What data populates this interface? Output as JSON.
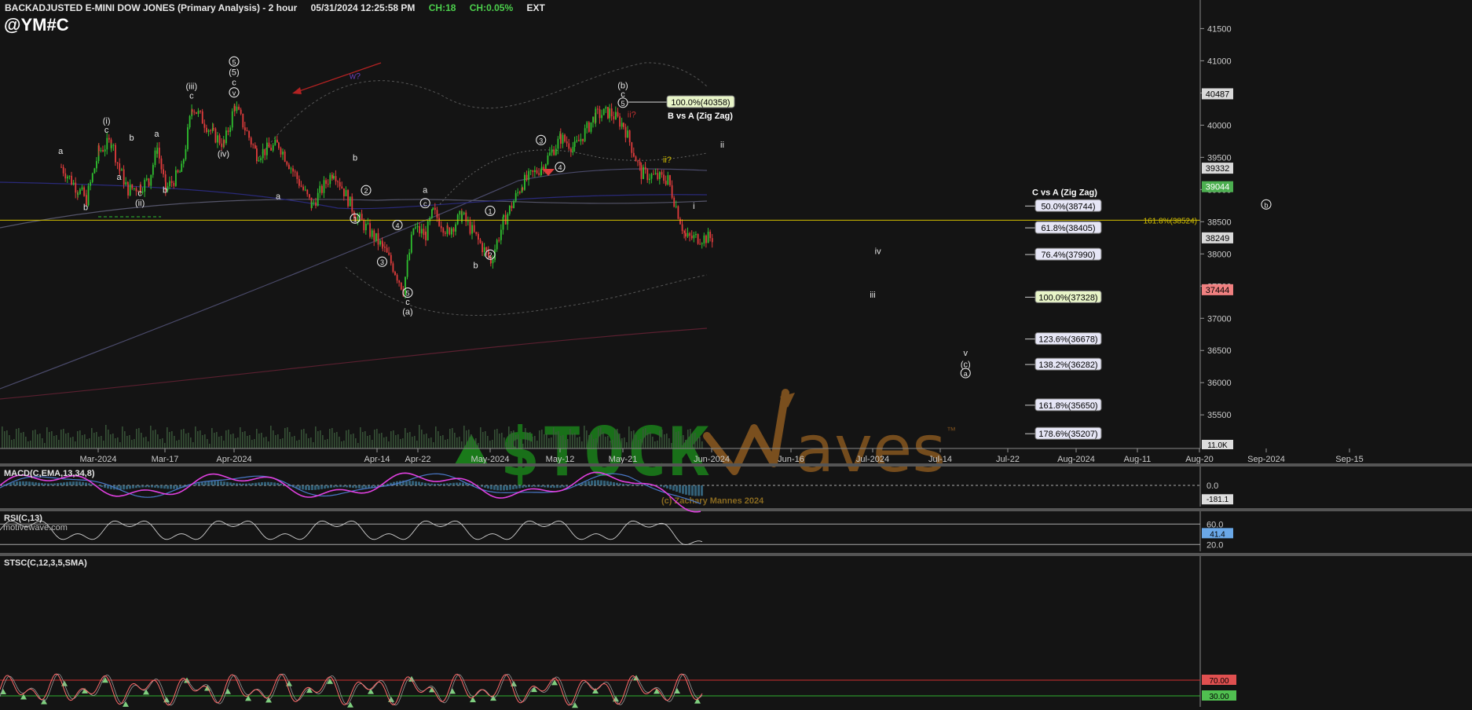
{
  "header": {
    "title": "BACKADJUSTED E-MINI DOW JONES (Primary Analysis) - 2 hour",
    "datetime": "05/31/2024 12:25:58 PM",
    "ch": "CH:18",
    "ch_pct": "CH:0.05%",
    "ext": "EXT",
    "symbol": "@YM#C"
  },
  "watermark": {
    "brand_left": "$TOCK",
    "brand_right": "aves",
    "tm": "™",
    "copyright": "(c) Zachary Mannes 2024",
    "credit": "motivewave.com"
  },
  "colors": {
    "background": "#141414",
    "up_candle": "#2fbf2f",
    "down_candle": "#e03c3c",
    "fib_line": "#d4c000",
    "macd": "#e040e0",
    "rsi": "#cfcfcf",
    "stoch": "#ff6b6b",
    "brand_green": "#1a7a1a",
    "brand_brown": "#7a4f1e"
  },
  "chart_data": {
    "type": "line",
    "title": "BACKADJUSTED E-MINI DOW JONES (Primary Analysis) - 2 hour",
    "x_ticks": [
      "Mar-2024",
      "Mar-17",
      "Apr-2024",
      "Apr-14",
      "Apr-22",
      "May-2024",
      "May-12",
      "May-21",
      "Jun-2024",
      "Jun-16",
      "Jul-2024",
      "Jul-14",
      "Jul-22",
      "Aug-2024",
      "Aug-11",
      "Aug-20",
      "Sep-2024",
      "Sep-15"
    ],
    "y_ticks": [
      35500,
      36000,
      36500,
      37000,
      37500,
      38000,
      38500,
      39000,
      39500,
      40000,
      40500,
      41000,
      41500
    ],
    "ylim": [
      35100,
      41700
    ],
    "price_path": [
      [
        "Feb-23",
        39350
      ],
      [
        "Feb-27",
        39000
      ],
      [
        "Feb-29",
        38850
      ],
      [
        "Mar-2024",
        39600
      ],
      [
        "Mar-04",
        39750
      ],
      [
        "Mar-06",
        39300
      ],
      [
        "Mar-08",
        39000
      ],
      [
        "Mar-11",
        39050
      ],
      [
        "Mar-13",
        39150
      ],
      [
        "Mar-15",
        39650
      ],
      [
        "Mar-17",
        39000
      ],
      [
        "Mar-20",
        39300
      ],
      [
        "Mar-22",
        40300
      ],
      [
        "Mar-26",
        39850
      ],
      [
        "Mar-28",
        39700
      ],
      [
        "Apr-2024",
        40300
      ],
      [
        "Apr-03",
        39550
      ],
      [
        "Apr-05",
        39700
      ],
      [
        "Apr-08",
        38750
      ],
      [
        "Apr-10",
        39300
      ],
      [
        "Apr-12",
        38600
      ],
      [
        "Apr-15",
        38100
      ],
      [
        "Apr-17",
        37800
      ],
      [
        "Apr-19",
        37450
      ],
      [
        "Apr-21",
        38400
      ],
      [
        "Apr-23",
        38300
      ],
      [
        "Apr-24",
        38650
      ],
      [
        "Apr-26",
        38350
      ],
      [
        "Apr-28",
        38600
      ],
      [
        "May-2024",
        37900
      ],
      [
        "May-03",
        38500
      ],
      [
        "May-06",
        39100
      ],
      [
        "May-09",
        39350
      ],
      [
        "May-12",
        39800
      ],
      [
        "May-14",
        39650
      ],
      [
        "May-17",
        40150
      ],
      [
        "May-19",
        40200
      ],
      [
        "May-21",
        40000
      ],
      [
        "May-23",
        39250
      ],
      [
        "May-26",
        39150
      ],
      [
        "May-28",
        38250
      ],
      [
        "May-31",
        38250
      ]
    ],
    "price_labels": [
      {
        "value": 40487,
        "label": "40487",
        "bg": "#d9d9d9",
        "fg": "#000"
      },
      {
        "value": 39332,
        "label": "39332",
        "bg": "#d9d9d9",
        "fg": "#000"
      },
      {
        "value": 39044,
        "label": "39044",
        "bg": "#4caf50",
        "fg": "#fff"
      },
      {
        "value": 38249,
        "label": "38249",
        "bg": "#d9d9d9",
        "fg": "#000"
      },
      {
        "value": 37444,
        "label": "37444",
        "bg": "#f08080",
        "fg": "#000"
      }
    ],
    "volume_label": "11.0K",
    "horizontal_line": {
      "value": 38524,
      "label": "161.8%(38524)"
    },
    "fib_targets_b": {
      "title": "B vs A (Zig Zag)",
      "levels": [
        {
          "label": "100.0%(40358)",
          "value": 40358
        }
      ]
    },
    "fib_targets_c": {
      "title": "C vs A (Zig Zag)",
      "levels": [
        {
          "label": "50.0%(38744)",
          "value": 38744
        },
        {
          "label": "61.8%(38405)",
          "value": 38405
        },
        {
          "label": "76.4%(37990)",
          "value": 37990
        },
        {
          "label": "100.0%(37328)",
          "value": 37328
        },
        {
          "label": "123.6%(36678)",
          "value": 36678
        },
        {
          "label": "138.2%(36282)",
          "value": 36282
        },
        {
          "label": "161.8%(35650)",
          "value": 35650
        },
        {
          "label": "178.6%(35207)",
          "value": 35207
        }
      ]
    },
    "wave_labels": [
      {
        "t": "a",
        "x": "Feb-23",
        "p": 39550
      },
      {
        "t": "b",
        "x": "Feb-29",
        "p": 38680
      },
      {
        "t": "(i)",
        "x": "Mar-03",
        "p": 40020
      },
      {
        "t": "c",
        "x": "Mar-03",
        "p": 39880
      },
      {
        "t": "a",
        "x": "Mar-06",
        "p": 39150
      },
      {
        "t": "b",
        "x": "Mar-09",
        "p": 39760
      },
      {
        "t": "c",
        "x": "Mar-11",
        "p": 38900
      },
      {
        "t": "(ii)",
        "x": "Mar-11",
        "p": 38750
      },
      {
        "t": "a",
        "x": "Mar-15",
        "p": 39820
      },
      {
        "t": "b",
        "x": "Mar-17",
        "p": 38950
      },
      {
        "t": "(iii)",
        "x": "Mar-22",
        "p": 40560
      },
      {
        "t": "c",
        "x": "Mar-22",
        "p": 40410
      },
      {
        "t": "(iv)",
        "x": "Mar-28",
        "p": 39510
      },
      {
        "t": "5",
        "x": "Apr-2024",
        "p": 40940,
        "circle": true
      },
      {
        "t": "(5)",
        "x": "Apr-2024",
        "p": 40780
      },
      {
        "t": "c",
        "x": "Apr-2024",
        "p": 40620
      },
      {
        "t": "v",
        "x": "Apr-2024",
        "p": 40460,
        "circle": true
      },
      {
        "t": "a",
        "x": "Apr-05",
        "p": 38850
      },
      {
        "t": "b",
        "x": "Apr-12",
        "p": 39450
      },
      {
        "t": "2",
        "x": "Apr-13",
        "p": 38940,
        "circle": true
      },
      {
        "t": "1",
        "x": "Apr-12",
        "p": 38500,
        "circle": true
      },
      {
        "t": "3",
        "x": "Apr-15",
        "p": 37830,
        "circle": true
      },
      {
        "t": "4",
        "x": "Apr-18",
        "p": 38400,
        "circle": true
      },
      {
        "t": "5",
        "x": "Apr-20",
        "p": 37350,
        "circle": true
      },
      {
        "t": "c",
        "x": "Apr-20",
        "p": 37210
      },
      {
        "t": "(a)",
        "x": "Apr-20",
        "p": 37060
      },
      {
        "t": "a",
        "x": "Apr-23",
        "p": 38950
      },
      {
        "t": "c",
        "x": "Apr-23",
        "p": 38740,
        "circle": true
      },
      {
        "t": "1",
        "x": "May-2024",
        "p": 38620,
        "circle": true
      },
      {
        "t": "2",
        "x": "May-2024",
        "p": 37940,
        "circle": true
      },
      {
        "t": "b",
        "x": "Apr-30",
        "p": 37780
      },
      {
        "t": "3",
        "x": "May-09",
        "p": 39720,
        "circle": true
      },
      {
        "t": "4",
        "x": "May-12",
        "p": 39300,
        "circle": true
      },
      {
        "t": "(b)",
        "x": "May-21",
        "p": 40570
      },
      {
        "t": "c",
        "x": "May-21",
        "p": 40440
      },
      {
        "t": "5",
        "x": "May-21",
        "p": 40300,
        "circle": true
      },
      {
        "t": "ii?",
        "x": "May-22",
        "p": 40120
      },
      {
        "t": "ii?",
        "x": "May-26",
        "p": 39420
      },
      {
        "t": "i",
        "x": "May-29",
        "p": 38700
      },
      {
        "t": "ii",
        "x": "Jun-03",
        "p": 39650
      },
      {
        "t": "iii",
        "x": "Jul-2024",
        "p": 37320
      },
      {
        "t": "iv",
        "x": "Jul-02",
        "p": 38000
      },
      {
        "t": "v",
        "x": "Jul-17",
        "p": 36420
      },
      {
        "t": "(c)",
        "x": "Jul-17",
        "p": 36240
      },
      {
        "t": "a",
        "x": "Jul-17",
        "p": 36100,
        "circle": true
      },
      {
        "t": "b",
        "x": "Sep-01",
        "p": 38720,
        "circle": true
      },
      {
        "t": "w?",
        "x": "Apr-12",
        "p": 40720
      }
    ],
    "macd": {
      "label": "MACD(C,EMA,13,34,8)",
      "ticks": [
        "0.0",
        "-181.1"
      ],
      "ylim": [
        -700,
        600
      ]
    },
    "rsi": {
      "label": "RSI(C,13)",
      "ticks": [
        "60.0",
        "41.4",
        "20.0"
      ],
      "ylim": [
        5,
        85
      ]
    },
    "stoch": {
      "label": "STSC(C,12,3,5,SMA)",
      "ticks": [
        "70.00",
        "30.00"
      ],
      "ylim": [
        0,
        110
      ]
    }
  }
}
